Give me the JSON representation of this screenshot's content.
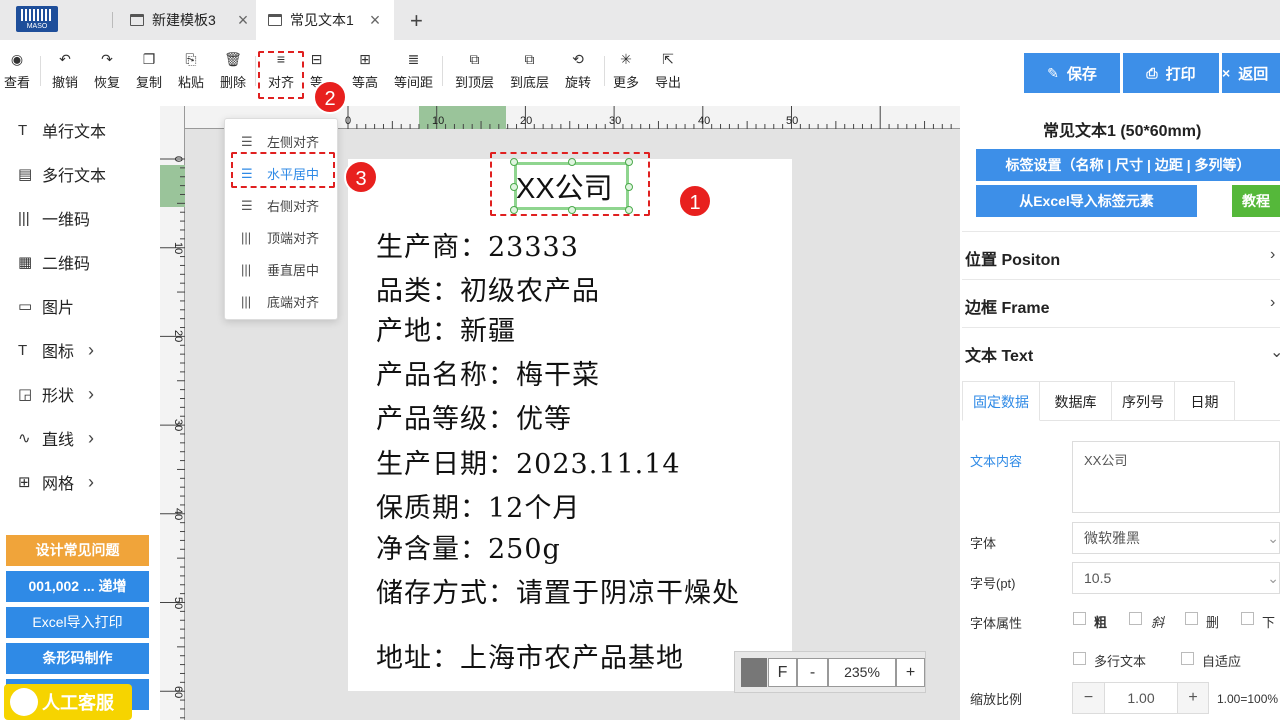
{
  "tabs": [
    {
      "label": "新建模板3"
    },
    {
      "label": "常见文本1"
    }
  ],
  "logo_text": "MASO",
  "toolbar": {
    "view": "查看",
    "undo": "撤销",
    "redo": "恢复",
    "copy": "复制",
    "paste": "粘贴",
    "delete": "删除",
    "align": "对齐",
    "equal_width": "等",
    "equal_height": "等高",
    "equal_spacing": "等间距",
    "to_top": "到顶层",
    "to_bottom": "到底层",
    "rotate": "旋转",
    "more": "更多",
    "export": "导出"
  },
  "actions": {
    "save": "保存",
    "print": "打印",
    "back": "返回"
  },
  "badges": [
    "1",
    "2",
    "3"
  ],
  "sidebar": {
    "items": [
      {
        "label": "单行文本"
      },
      {
        "label": "多行文本"
      },
      {
        "label": "一维码"
      },
      {
        "label": "二维码"
      },
      {
        "label": "图片"
      },
      {
        "label": "图标"
      },
      {
        "label": "形状"
      },
      {
        "label": "直线"
      },
      {
        "label": "网格"
      }
    ],
    "buttons": [
      "设计常见问题",
      "001,002 ... 递增",
      "Excel导入打印",
      "条形码制作"
    ],
    "chat": "人工客服"
  },
  "ruler": {
    "top": [
      "0",
      "10",
      "20",
      "30",
      "40",
      "50"
    ],
    "left": [
      "0",
      "10",
      "20",
      "30",
      "40",
      "50",
      "60"
    ]
  },
  "label": {
    "selected_text": "XX公司",
    "lines": [
      "生产商：23333",
      "品类：初级农产品",
      "产地：新疆",
      "产品名称：梅干菜",
      "产品等级：优等",
      "生产日期：2023.11.14",
      "保质期：12个月",
      "净含量：250g",
      "储存方式：请置于阴凉干燥处",
      "地址：上海市农产品基地"
    ]
  },
  "zoom": {
    "f": "F",
    "minus": "-",
    "value": "235%",
    "plus": "+"
  },
  "align_menu": [
    {
      "label": "左侧对齐"
    },
    {
      "label": "水平居中"
    },
    {
      "label": "右侧对齐"
    },
    {
      "label": "顶端对齐"
    },
    {
      "label": "垂直居中"
    },
    {
      "label": "底端对齐"
    }
  ],
  "panel": {
    "title": "常见文本1 (50*60mm)",
    "label_settings": "标签设置（名称 | 尺寸 | 边距 | 多列等）",
    "excel_import": "从Excel导入标签元素",
    "tutorial": "教程",
    "sections": {
      "position": "位置 Positon",
      "frame": "边框 Frame",
      "text": "文本 Text"
    },
    "subtabs": [
      "固定数据",
      "数据库",
      "序列号",
      "日期"
    ],
    "text_content_label": "文本内容",
    "text_content": "XX公司",
    "font_label": "字体",
    "font_value": "微软雅黑",
    "size_label": "字号(pt)",
    "size_value": "10.5",
    "attr_label": "字体属性",
    "attrs": [
      "粗",
      "斜",
      "删",
      "下"
    ],
    "multiline": "多行文本",
    "autofit": "自适应",
    "scale_label": "缩放比例",
    "scale_minus": "−",
    "scale_value": "1.00",
    "scale_plus": "+",
    "scale_note": "1.00=100%"
  },
  "colors": {
    "accent": "#3d8fe8",
    "highlight": "#e02020",
    "selection": "#8fd58f"
  }
}
